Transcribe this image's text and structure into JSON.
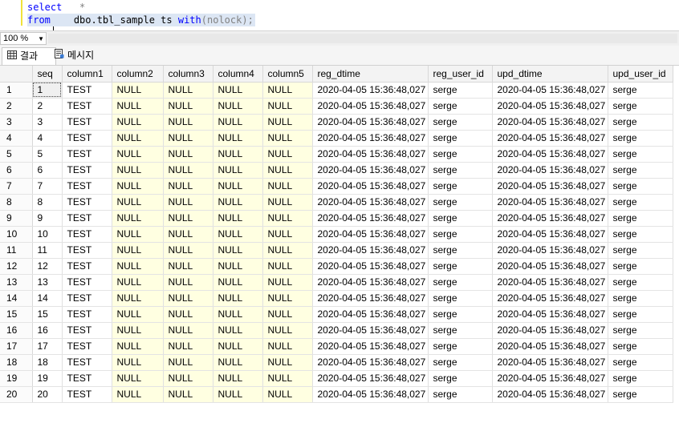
{
  "editor": {
    "line1_kw": "select",
    "line1_rest": "*",
    "line2_kw": "from",
    "line2_obj": "dbo.tbl_sample ts ",
    "line2_kw2": "with",
    "line2_fn": "(nolock);"
  },
  "zoom": {
    "value": "100 %"
  },
  "tabs": {
    "results": "결과",
    "messages": "메시지"
  },
  "grid": {
    "columns": [
      "seq",
      "column1",
      "column2",
      "column3",
      "column4",
      "column5",
      "reg_dtime",
      "reg_user_id",
      "upd_dtime",
      "upd_user_id"
    ],
    "rows": [
      [
        "1",
        "TEST",
        "NULL",
        "NULL",
        "NULL",
        "NULL",
        "2020-04-05 15:36:48,027",
        "serge",
        "2020-04-05 15:36:48,027",
        "serge"
      ],
      [
        "2",
        "TEST",
        "NULL",
        "NULL",
        "NULL",
        "NULL",
        "2020-04-05 15:36:48,027",
        "serge",
        "2020-04-05 15:36:48,027",
        "serge"
      ],
      [
        "3",
        "TEST",
        "NULL",
        "NULL",
        "NULL",
        "NULL",
        "2020-04-05 15:36:48,027",
        "serge",
        "2020-04-05 15:36:48,027",
        "serge"
      ],
      [
        "4",
        "TEST",
        "NULL",
        "NULL",
        "NULL",
        "NULL",
        "2020-04-05 15:36:48,027",
        "serge",
        "2020-04-05 15:36:48,027",
        "serge"
      ],
      [
        "5",
        "TEST",
        "NULL",
        "NULL",
        "NULL",
        "NULL",
        "2020-04-05 15:36:48,027",
        "serge",
        "2020-04-05 15:36:48,027",
        "serge"
      ],
      [
        "6",
        "TEST",
        "NULL",
        "NULL",
        "NULL",
        "NULL",
        "2020-04-05 15:36:48,027",
        "serge",
        "2020-04-05 15:36:48,027",
        "serge"
      ],
      [
        "7",
        "TEST",
        "NULL",
        "NULL",
        "NULL",
        "NULL",
        "2020-04-05 15:36:48,027",
        "serge",
        "2020-04-05 15:36:48,027",
        "serge"
      ],
      [
        "8",
        "TEST",
        "NULL",
        "NULL",
        "NULL",
        "NULL",
        "2020-04-05 15:36:48,027",
        "serge",
        "2020-04-05 15:36:48,027",
        "serge"
      ],
      [
        "9",
        "TEST",
        "NULL",
        "NULL",
        "NULL",
        "NULL",
        "2020-04-05 15:36:48,027",
        "serge",
        "2020-04-05 15:36:48,027",
        "serge"
      ],
      [
        "10",
        "TEST",
        "NULL",
        "NULL",
        "NULL",
        "NULL",
        "2020-04-05 15:36:48,027",
        "serge",
        "2020-04-05 15:36:48,027",
        "serge"
      ],
      [
        "11",
        "TEST",
        "NULL",
        "NULL",
        "NULL",
        "NULL",
        "2020-04-05 15:36:48,027",
        "serge",
        "2020-04-05 15:36:48,027",
        "serge"
      ],
      [
        "12",
        "TEST",
        "NULL",
        "NULL",
        "NULL",
        "NULL",
        "2020-04-05 15:36:48,027",
        "serge",
        "2020-04-05 15:36:48,027",
        "serge"
      ],
      [
        "13",
        "TEST",
        "NULL",
        "NULL",
        "NULL",
        "NULL",
        "2020-04-05 15:36:48,027",
        "serge",
        "2020-04-05 15:36:48,027",
        "serge"
      ],
      [
        "14",
        "TEST",
        "NULL",
        "NULL",
        "NULL",
        "NULL",
        "2020-04-05 15:36:48,027",
        "serge",
        "2020-04-05 15:36:48,027",
        "serge"
      ],
      [
        "15",
        "TEST",
        "NULL",
        "NULL",
        "NULL",
        "NULL",
        "2020-04-05 15:36:48,027",
        "serge",
        "2020-04-05 15:36:48,027",
        "serge"
      ],
      [
        "16",
        "TEST",
        "NULL",
        "NULL",
        "NULL",
        "NULL",
        "2020-04-05 15:36:48,027",
        "serge",
        "2020-04-05 15:36:48,027",
        "serge"
      ],
      [
        "17",
        "TEST",
        "NULL",
        "NULL",
        "NULL",
        "NULL",
        "2020-04-05 15:36:48,027",
        "serge",
        "2020-04-05 15:36:48,027",
        "serge"
      ],
      [
        "18",
        "TEST",
        "NULL",
        "NULL",
        "NULL",
        "NULL",
        "2020-04-05 15:36:48,027",
        "serge",
        "2020-04-05 15:36:48,027",
        "serge"
      ],
      [
        "19",
        "TEST",
        "NULL",
        "NULL",
        "NULL",
        "NULL",
        "2020-04-05 15:36:48,027",
        "serge",
        "2020-04-05 15:36:48,027",
        "serge"
      ],
      [
        "20",
        "TEST",
        "NULL",
        "NULL",
        "NULL",
        "NULL",
        "2020-04-05 15:36:48,027",
        "serge",
        "2020-04-05 15:36:48,027",
        "serge"
      ]
    ],
    "null_cell_color": "#ffffe1"
  }
}
